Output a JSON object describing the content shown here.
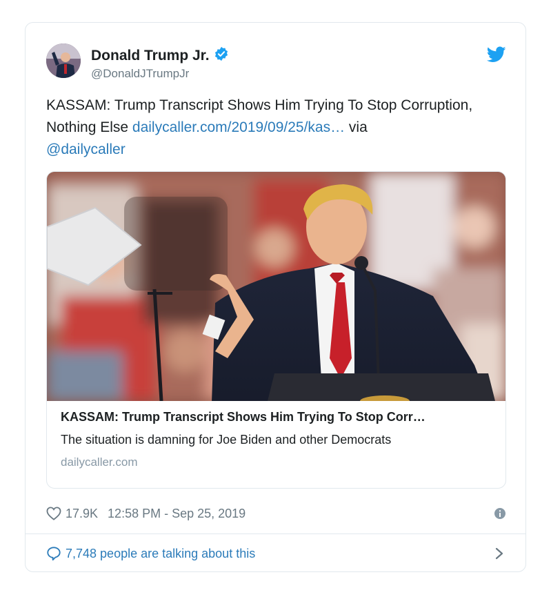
{
  "tweet": {
    "author_name": "Donald Trump Jr.",
    "handle": "@DonaldJTrumpJr",
    "text_plain": "KASSAM: Trump Transcript Shows Him Trying To Stop Corruption, Nothing Else ",
    "text_link": "dailycaller.com/2019/09/25/kas…",
    "text_via": " via ",
    "mention": "@dailycaller"
  },
  "card": {
    "title": "KASSAM: Trump Transcript Shows Him Trying To Stop Corr…",
    "description": "The situation is damning for Joe Biden and other Democrats",
    "domain": "dailycaller.com"
  },
  "meta": {
    "likes": "17.9K",
    "timestamp": "12:58 PM - Sep 25, 2019"
  },
  "footer": {
    "talking": "7,748 people are talking about this"
  },
  "colors": {
    "link": "#2b7bb9",
    "verified": "#1da1f2",
    "muted": "#697882"
  },
  "icons": [
    "verified-badge-icon",
    "twitter-bird-icon",
    "heart-icon",
    "info-icon",
    "speech-bubble-icon",
    "chevron-right-icon"
  ]
}
